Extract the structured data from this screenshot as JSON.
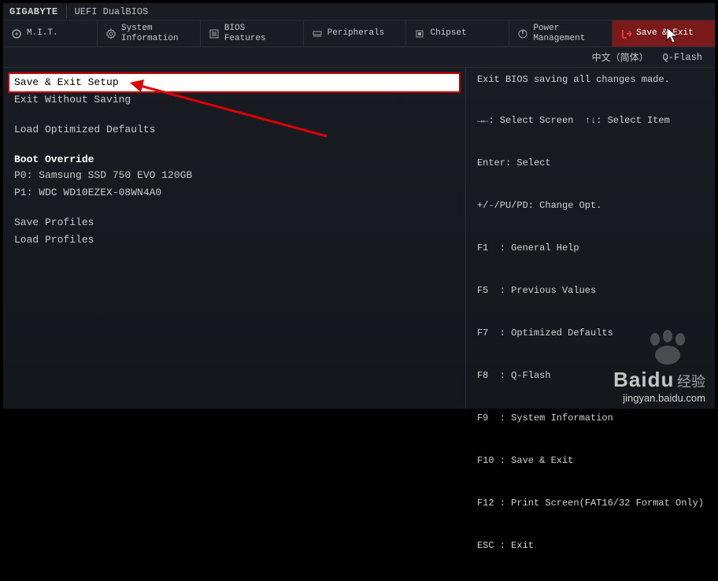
{
  "header": {
    "brand": "GIGABYTE",
    "subbrand": "UEFI DualBIOS"
  },
  "tabs": [
    {
      "label": "M.I.T.",
      "icon": "mit-icon"
    },
    {
      "label": "System\nInformation",
      "icon": "gear-icon"
    },
    {
      "label": "BIOS\nFeatures",
      "icon": "list-icon"
    },
    {
      "label": "Peripherals",
      "icon": "device-icon"
    },
    {
      "label": "Chipset",
      "icon": "chip-icon"
    },
    {
      "label": "Power\nManagement",
      "icon": "power-icon"
    },
    {
      "label": "Save & Exit",
      "icon": "exit-icon",
      "active": true
    }
  ],
  "subbar": {
    "language": "中文（简体）",
    "qflash": "Q-Flash"
  },
  "menu": {
    "items": [
      {
        "label": "Save & Exit Setup",
        "selected": true
      },
      {
        "label": "Exit Without Saving"
      }
    ],
    "items2": [
      {
        "label": "Load Optimized Defaults"
      }
    ],
    "boot_override_header": "Boot Override",
    "boot_override": [
      {
        "label": "P0: Samsung SSD 750 EVO 120GB"
      },
      {
        "label": "P1: WDC WD10EZEX-08WN4A0"
      }
    ],
    "items3": [
      {
        "label": "Save Profiles"
      },
      {
        "label": "Load Profiles"
      }
    ]
  },
  "help": {
    "text": "Exit BIOS saving all changes made."
  },
  "legend": {
    "l1": "→←: Select Screen  ↑↓: Select Item",
    "l2": "Enter: Select",
    "l3": "+/-/PU/PD: Change Opt.",
    "l4": "F1  : General Help",
    "l5": "F5  : Previous Values",
    "l6": "F7  : Optimized Defaults",
    "l8": "F8  : Q-Flash",
    "l9": "F9  : System Information",
    "l10": "F10 : Save & Exit",
    "l12": "F12 : Print Screen(FAT16/32 Format Only)",
    "l13": "ESC : Exit"
  },
  "watermark": {
    "brand": "Baidu",
    "cn": "经验",
    "url": "jingyan.baidu.com"
  }
}
